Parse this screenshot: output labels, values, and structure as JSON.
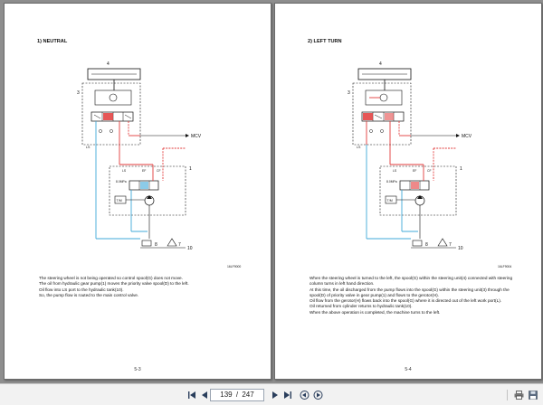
{
  "pages": [
    {
      "section_title": "1) NEUTRAL",
      "figure_id": "16LF9000",
      "labels": {
        "n1": "1",
        "n3": "3",
        "n4": "4",
        "n5": "5",
        "n6": "6",
        "n7": "7",
        "n8": "8",
        "n10": "10",
        "mcv": "MCV",
        "tm": "T/M",
        "ls": "LS",
        "ef": "EF",
        "cf": "CF",
        "p": "P",
        "t": "T",
        "pr": "8.0MPa"
      },
      "paragraphs": [
        "The steering wheel is not being operated so control spool(G) does not move.",
        "The oil from hydraulic gear pump(1) moves the priority valve spool(D) to the left.",
        "Oil flow into LS port to the hydraulic tank(10).",
        "So, the pump flow is routed to the main control valve."
      ],
      "page_number": "5-3"
    },
    {
      "section_title": "2) LEFT TURN",
      "figure_id": "16LF9004",
      "labels": {
        "n1": "1",
        "n3": "3",
        "n4": "4",
        "n5": "5",
        "n6": "6",
        "n7": "7",
        "n8": "8",
        "n10": "10",
        "mcv": "MCV",
        "tm": "T/M",
        "ls": "LS",
        "ef": "EF",
        "cf": "CF",
        "p": "P",
        "t": "T",
        "pr": "8.0MPa"
      },
      "paragraphs": [
        "When the steering wheel is turned to the left, the spool(G) within the steering unit(4) connected with steering column turns in left hand direction.",
        "At this time, the oil discharged from the pump flows into the spool(G) within the steering unit(3) through the spool(D) of priority valve in gear pump(1) and flows to the gerotor(H).",
        "Oil flow from the gerotor(H) flows back into the spool(G) where it is directed out of the left work port(L).",
        "Oil returned from cylinder returns to hydraulic tank(10).",
        "When the above operation is completed, the machine turns to the left."
      ],
      "page_number": "5-4"
    }
  ],
  "toolbar": {
    "current_page": "139",
    "separator": "/",
    "total_pages": "247",
    "icons": [
      "first-page-icon",
      "previous-page-icon",
      "next-page-icon",
      "last-page-icon",
      "back-icon",
      "forward-icon",
      "print-icon",
      "save-icon"
    ]
  },
  "colors": {
    "pressure_line": "#e23a3a",
    "return_line": "#3fa9d8",
    "pilot_line": "#e23a3a"
  }
}
